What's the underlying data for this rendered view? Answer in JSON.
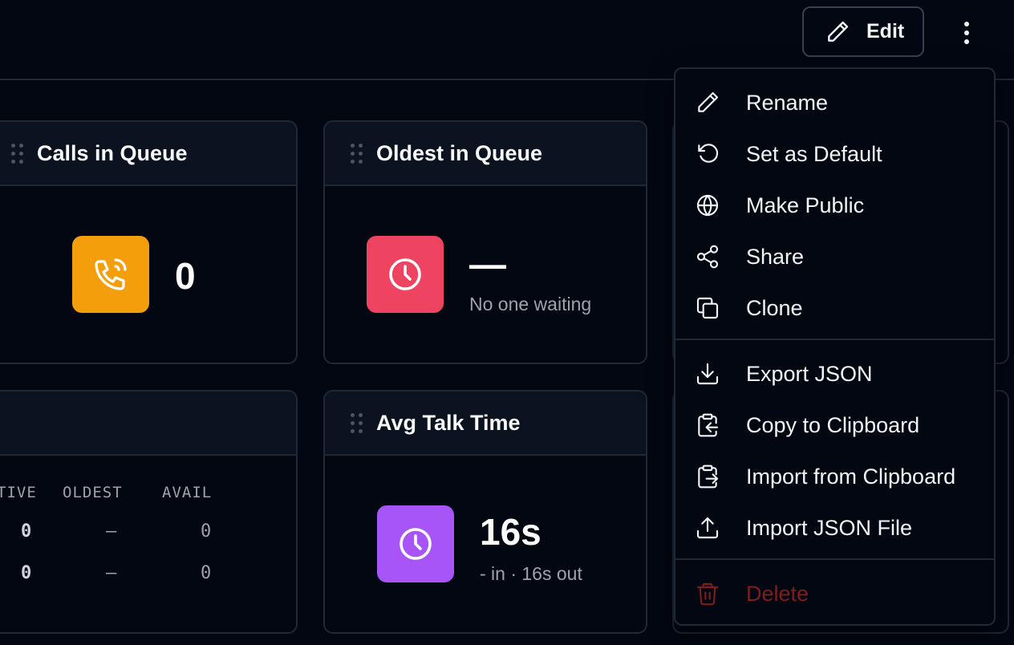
{
  "toolbar": {
    "edit_label": "Edit"
  },
  "cards": {
    "calls_in_queue": {
      "title": "Calls in Queue",
      "value": "0",
      "icon": "phone-ringing-icon",
      "icon_color": "#f59e0b"
    },
    "oldest_in_queue": {
      "title": "Oldest in Queue",
      "value": "—",
      "subtitle": "No one waiting",
      "icon": "clock-icon",
      "icon_color": "#ef4461"
    },
    "queue_table": {
      "headers": [
        "TIVE",
        "OLDEST",
        "AVAIL"
      ],
      "rows": [
        [
          "0",
          "—",
          "0"
        ],
        [
          "0",
          "—",
          "0"
        ]
      ]
    },
    "avg_talk_time": {
      "title": "Avg Talk Time",
      "value": "16s",
      "subtitle": "- in · 16s out",
      "icon": "clock-icon",
      "icon_color": "#a855f7"
    }
  },
  "menu": {
    "items": [
      {
        "label": "Rename",
        "icon": "pencil-icon"
      },
      {
        "label": "Set as Default",
        "icon": "rotate-ccw-icon"
      },
      {
        "label": "Make Public",
        "icon": "globe-icon"
      },
      {
        "label": "Share",
        "icon": "share-icon"
      },
      {
        "label": "Clone",
        "icon": "copy-icon"
      },
      {
        "label": "Export JSON",
        "icon": "download-icon"
      },
      {
        "label": "Copy to Clipboard",
        "icon": "clipboard-copy-icon"
      },
      {
        "label": "Import from Clipboard",
        "icon": "clipboard-import-icon"
      },
      {
        "label": "Import JSON File",
        "icon": "upload-icon"
      },
      {
        "label": "Delete",
        "icon": "trash-icon"
      }
    ],
    "danger_color": "#7f1d1d"
  }
}
